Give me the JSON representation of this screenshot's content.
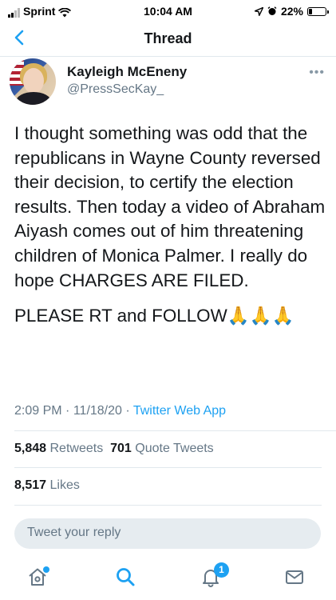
{
  "status_bar": {
    "carrier": "Sprint",
    "time": "10:04 AM",
    "battery": "22%",
    "battery_level": 0.22
  },
  "header": {
    "title": "Thread"
  },
  "tweet": {
    "author_name": "Kayleigh McEneny",
    "author_handle": "@PressSecKay_",
    "text": "I thought something was odd that the republicans in Wayne County reversed their decision, to certify the election results. Then today a video of Abraham Aiyash comes out of him threatening children of Monica Palmer. I really do hope CHARGES ARE FILED.",
    "text2": "PLEASE RT and FOLLOW🙏🙏🙏",
    "time": "2:09 PM",
    "date": "11/18/20",
    "app": "Twitter Web App",
    "retweets_count": "5,848",
    "retweets_label": "Retweets",
    "quotes_count": "701",
    "quotes_label": "Quote Tweets",
    "likes_count": "8,517",
    "likes_label": "Likes"
  },
  "reply": {
    "placeholder": "Tweet your reply"
  },
  "tab_bar": {
    "notifications_badge": "1"
  },
  "colors": {
    "accent": "#1da1f2",
    "muted": "#657786",
    "separator": "#e1e8ed"
  },
  "icons": [
    "back-chevron-icon",
    "more-icon",
    "reply-icon",
    "retweet-icon",
    "like-icon",
    "share-icon",
    "home-icon",
    "search-icon",
    "notifications-icon",
    "messages-icon"
  ]
}
